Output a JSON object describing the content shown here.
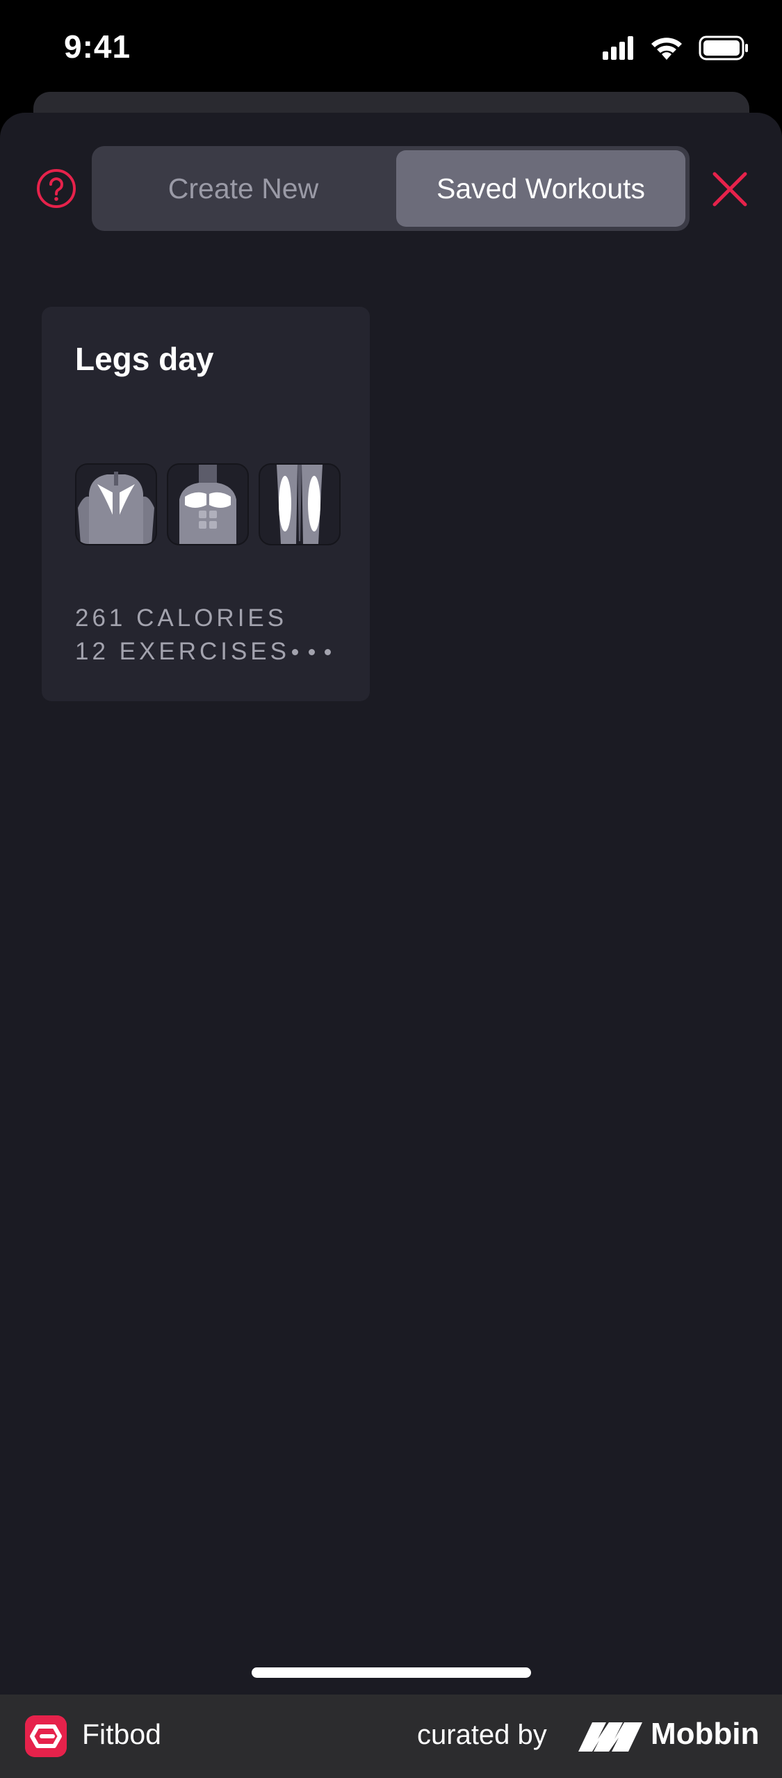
{
  "status_bar": {
    "time": "9:41"
  },
  "header": {
    "help_icon": "question-circle-icon",
    "tabs": [
      {
        "label": "Create New",
        "selected": false
      },
      {
        "label": "Saved Workouts",
        "selected": true
      }
    ],
    "close_icon": "close-icon"
  },
  "workouts": [
    {
      "title": "Legs day",
      "muscle_icons": [
        "back-muscles-icon",
        "chest-abs-muscles-icon",
        "legs-muscles-icon"
      ],
      "calories": "261 CALORIES",
      "exercises": "12 EXERCISES",
      "more_icon": "more-dots-icon"
    }
  ],
  "footer": {
    "app_name": "Fitbod",
    "curated_by": "curated by",
    "curator": "Mobbin"
  },
  "colors": {
    "accent": "#e6224b",
    "sheet_background": "#1b1b23",
    "card_background": "#25252f",
    "selected_tab": "#6c6c7a"
  }
}
